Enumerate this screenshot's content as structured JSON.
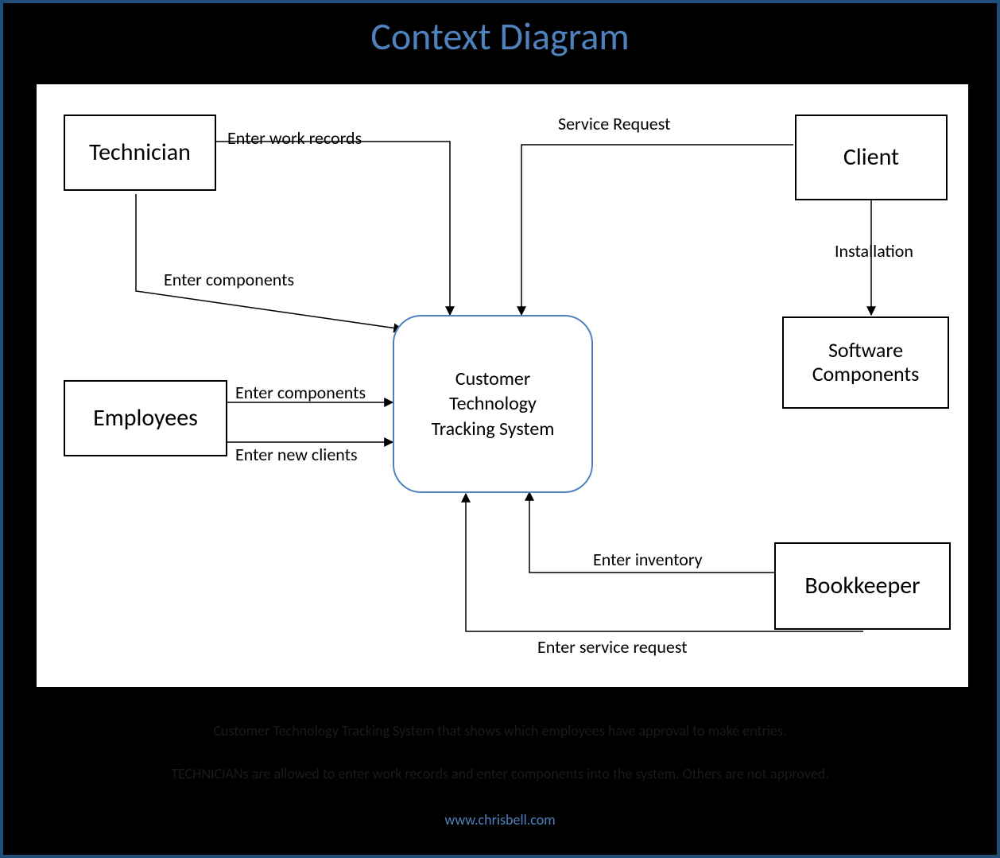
{
  "title": "Context Diagram",
  "process": {
    "name": "Customer\nTechnology\nTracking System"
  },
  "entities": {
    "technician": "Technician",
    "employees": "Employees",
    "client": "Client",
    "software": "Software\nComponents",
    "bookkeeper": "Bookkeeper"
  },
  "flows": {
    "tech_work_records": "Enter work records",
    "tech_components": "Enter components",
    "emp_components": "Enter components",
    "emp_new_clients": "Enter new clients",
    "client_service_req": "Service Request",
    "client_installation": "Installation",
    "book_inventory": "Enter inventory",
    "book_service_req": "Enter service request"
  },
  "captions": {
    "line1": "Customer Technology Tracking System that shows which employees have approval to make entries.",
    "line2": "TECHNICIANs are allowed to enter work records and enter components into the system. Others are not approved.",
    "url": "www.chrisbell.com"
  }
}
